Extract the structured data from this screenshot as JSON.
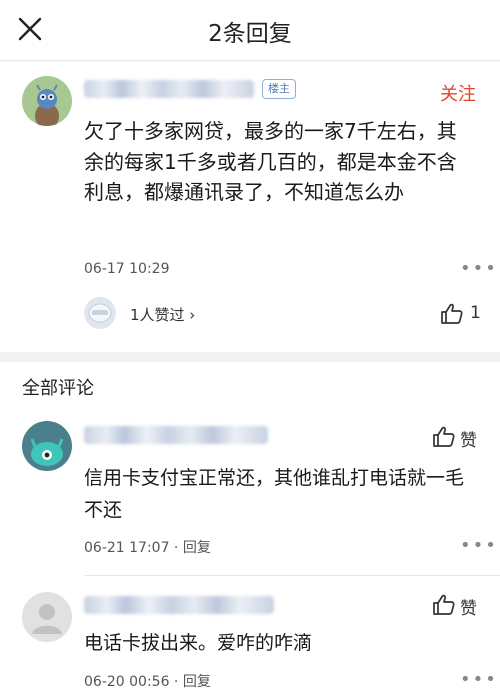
{
  "header": {
    "title": "2条回复"
  },
  "post": {
    "badge": "楼主",
    "follow_label": "关注",
    "text": "欠了十多家网贷，最多的一家7千左右，其余的每家1千多或者几百的，都是本金不含利息，都爆通讯录了，不知道怎么办",
    "time": "06-17 10:29",
    "likers_text": "1人赞过 ›",
    "like_count": "1"
  },
  "comments_section": {
    "title": "全部评论"
  },
  "comments": [
    {
      "text": "信用卡支付宝正常还，其他谁乱打电话就一毛不还",
      "meta": "06-21 17:07 · 回复",
      "like_label": "赞"
    },
    {
      "text": "电话卡拔出来。爱咋的咋滴",
      "meta": "06-20 00:56 · 回复",
      "like_label": "赞"
    }
  ],
  "icons": {
    "close": "close-icon",
    "more": "more-dots-icon",
    "thumb": "thumbs-up-icon"
  },
  "colors": {
    "follow": "#e0462f",
    "badge": "#4a7bb5"
  }
}
